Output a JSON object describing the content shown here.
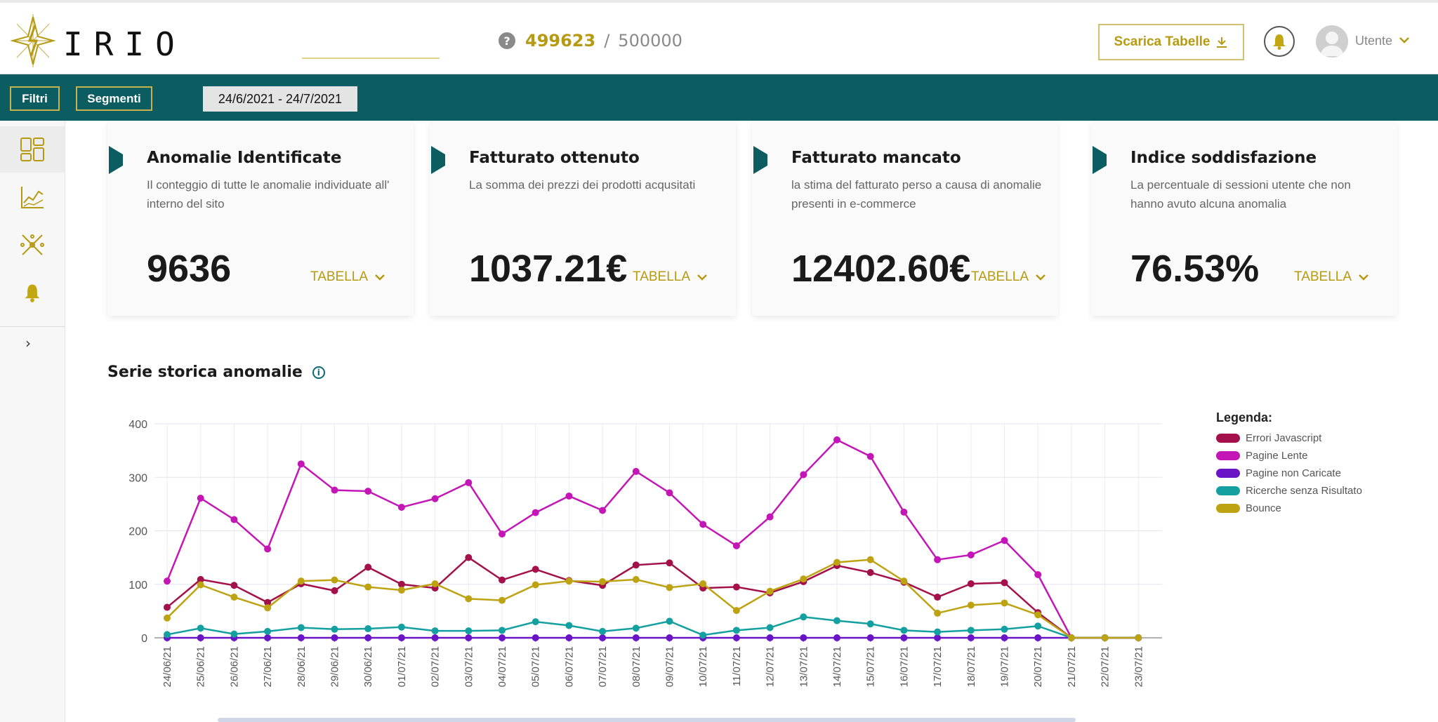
{
  "app": {
    "logo_text": "IRIO"
  },
  "header": {
    "counter_used": "499623",
    "counter_separator": "/",
    "counter_total": "500000",
    "download_label": "Scarica Tabelle",
    "user_label": "Utente"
  },
  "filters": {
    "filters_label": "Filtri",
    "segments_label": "Segmenti",
    "date_range": "24/6/2021 - 24/7/2021"
  },
  "sidebar": {
    "items": [
      {
        "icon": "dashboard-icon",
        "active": true
      },
      {
        "icon": "line-chart-icon",
        "active": false
      },
      {
        "icon": "network-icon",
        "active": false
      },
      {
        "icon": "bell-icon",
        "active": false
      }
    ]
  },
  "cards": [
    {
      "title": "Anomalie Identificate",
      "desc": "Il conteggio di tutte le anomalie individuate all' interno del sito",
      "value": "9636",
      "link": "TABELLA"
    },
    {
      "title": "Fatturato ottenuto",
      "desc": "La somma dei prezzi dei prodotti acqusitati",
      "value": "1037.21€",
      "link": "TABELLA"
    },
    {
      "title": "Fatturato mancato",
      "desc": "la stima del fatturato perso a causa di anomalie presenti in e-commerce",
      "value": "12402.60€",
      "link": "TABELLA"
    },
    {
      "title": "Indice soddisfazione",
      "desc": "La percentuale di sessioni utente che non hanno avuto alcuna anomalia",
      "value": "76.53%",
      "link": "TABELLA"
    }
  ],
  "colors": {
    "accent": "#b59a12",
    "teal": "#0c5d61"
  },
  "chart_section": {
    "title": "Serie storica anomalie",
    "legend_title": "Legenda:"
  },
  "chart_data": {
    "type": "line",
    "ylim": [
      0,
      400
    ],
    "yticks": [
      0,
      100,
      200,
      300,
      400
    ],
    "grid": true,
    "legend_position": "right",
    "categories": [
      "24/06/21",
      "25/06/21",
      "26/06/21",
      "27/06/21",
      "28/06/21",
      "29/06/21",
      "30/06/21",
      "01/07/21",
      "02/07/21",
      "03/07/21",
      "04/07/21",
      "05/07/21",
      "06/07/21",
      "07/07/21",
      "08/07/21",
      "09/07/21",
      "10/07/21",
      "11/07/21",
      "12/07/21",
      "13/07/21",
      "14/07/21",
      "15/07/21",
      "16/07/21",
      "17/07/21",
      "18/07/21",
      "19/07/21",
      "20/07/21",
      "21/07/21",
      "22/07/21",
      "23/07/21"
    ],
    "series": [
      {
        "name": "Errori Javascript",
        "color": "#a3104a",
        "values": [
          57,
          109,
          98,
          66,
          101,
          88,
          132,
          100,
          93,
          150,
          108,
          128,
          107,
          98,
          136,
          140,
          93,
          95,
          84,
          105,
          135,
          122,
          104,
          76,
          101,
          103,
          47,
          0,
          0,
          0
        ]
      },
      {
        "name": "Pagine Lente",
        "color": "#c416b6",
        "values": [
          106,
          261,
          221,
          166,
          325,
          276,
          274,
          244,
          260,
          290,
          194,
          234,
          265,
          238,
          311,
          271,
          212,
          172,
          226,
          305,
          370,
          339,
          235,
          146,
          155,
          182,
          118,
          0,
          0,
          0
        ]
      },
      {
        "name": "Pagine non Caricate",
        "color": "#6a14c8",
        "values": [
          0,
          0,
          0,
          0,
          0,
          0,
          0,
          0,
          0,
          0,
          0,
          0,
          0,
          0,
          0,
          0,
          0,
          0,
          0,
          0,
          0,
          0,
          0,
          0,
          0,
          0,
          0,
          0,
          0,
          0
        ]
      },
      {
        "name": "Ricerche senza Risultato",
        "color": "#14a0a0",
        "values": [
          6,
          18,
          7,
          12,
          19,
          16,
          17,
          20,
          13,
          13,
          14,
          30,
          23,
          12,
          18,
          31,
          5,
          14,
          19,
          39,
          32,
          26,
          14,
          11,
          14,
          16,
          22,
          0,
          0,
          0
        ]
      },
      {
        "name": "Bounce",
        "color": "#bda312",
        "values": [
          37,
          99,
          76,
          56,
          106,
          108,
          95,
          89,
          101,
          73,
          70,
          99,
          106,
          105,
          109,
          94,
          101,
          51,
          87,
          110,
          141,
          146,
          106,
          46,
          61,
          65,
          43,
          0,
          0,
          0
        ]
      }
    ]
  }
}
